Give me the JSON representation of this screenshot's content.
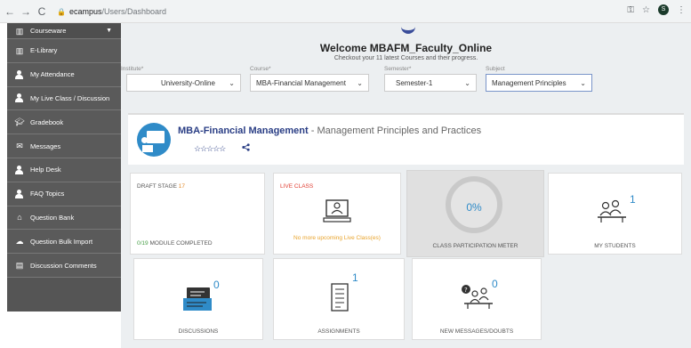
{
  "browser": {
    "back_icon": "←",
    "forward_icon": "→",
    "reload_icon": "C",
    "url_host": "ecampus",
    "url_path": "/Users/Dashboard",
    "avatar_letter": "S"
  },
  "sidebar": {
    "items": [
      {
        "label": "Courseware",
        "icon": "book-icon"
      },
      {
        "label": "E-Library",
        "icon": "library-icon"
      },
      {
        "label": "My Attendance",
        "icon": "person-icon"
      },
      {
        "label": "My Live Class / Discussion",
        "icon": "person-icon"
      },
      {
        "label": "Gradebook",
        "icon": "graduation-cap-icon"
      },
      {
        "label": "Messages",
        "icon": "envelope-icon"
      },
      {
        "label": "Help Desk",
        "icon": "person-icon"
      },
      {
        "label": "FAQ Topics",
        "icon": "person-icon"
      },
      {
        "label": "Question Bank",
        "icon": "bank-icon"
      },
      {
        "label": "Question Bulk Import",
        "icon": "cloud-upload-icon"
      },
      {
        "label": "Discussion Comments",
        "icon": "document-icon"
      }
    ]
  },
  "header": {
    "welcome": "Welcome MBAFM_Faculty_Online",
    "subtitle": "Checkout your 11 latest Courses and their progress."
  },
  "filters": {
    "institute": {
      "label": "Institute*",
      "value": "University-Online"
    },
    "course": {
      "label": "Course*",
      "value": "MBA-Financial Management"
    },
    "semester": {
      "label": "Semester*",
      "value": "Semester-1"
    },
    "subject": {
      "label": "Subject",
      "value": "Management Principles"
    }
  },
  "course_card": {
    "program": "MBA-Financial Management",
    "separator": " - ",
    "subject": "Management Principles and Practices",
    "stars": "☆☆☆☆☆",
    "share_icon": "<"
  },
  "tiles": {
    "draft_label": "DRAFT STAGE",
    "draft_count": "17",
    "module_done": "0/19",
    "module_label": "MODULE COMPLETED",
    "live_label": "LIVE CLASS",
    "no_live": "No more upcoming Live Class(es)",
    "meter_value": "0%",
    "meter_fraction": 0,
    "meter_label": "CLASS PARTICIPATION METER",
    "students_count": "1",
    "students_label": "MY STUDENTS",
    "discussions_count": "0",
    "discussions_label": "DISCUSSIONS",
    "assignments_count": "1",
    "assignments_label": "ASSIGNMENTS",
    "messages_count": "0",
    "messages_label": "NEW MESSAGES/DOUBTS"
  },
  "colors": {
    "sidebar": "#5a5a5a",
    "brand": "#2a3e85",
    "accent": "#2f8bc8",
    "live": "#e03c31",
    "warning": "#e8a32b"
  }
}
